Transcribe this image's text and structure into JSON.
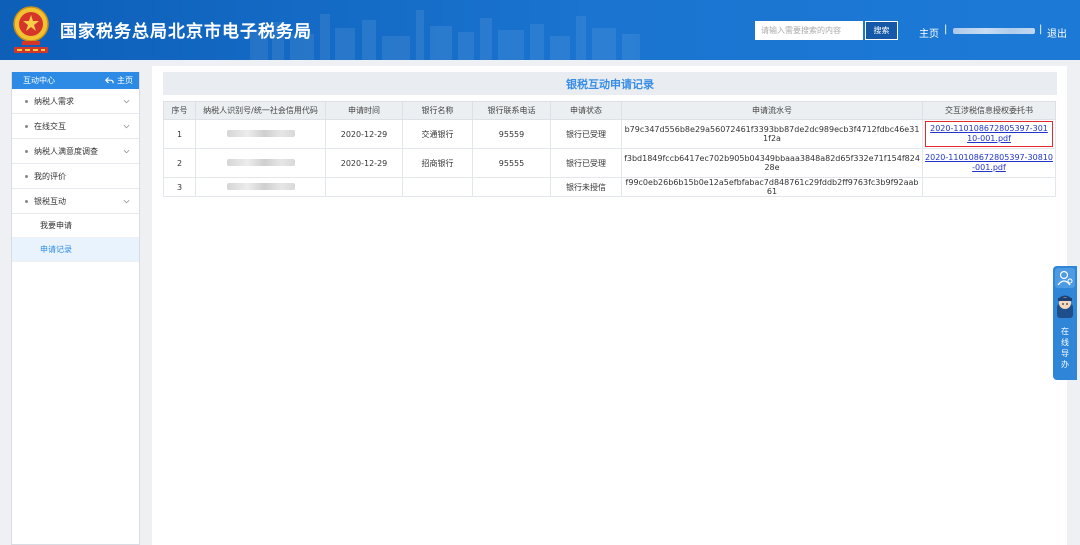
{
  "header": {
    "title": "国家税务总局北京市电子税务局",
    "search_placeholder": "请输入需要搜索的内容",
    "search_label": "搜索",
    "home_label": "主页",
    "separator": "|",
    "logout_label": "退出",
    "brand_color": "#1a6fcc"
  },
  "sidebar": {
    "header_label": "互动中心",
    "home_link": "主页",
    "items": [
      {
        "label": "纳税人需求",
        "icon": "chevron-down-icon"
      },
      {
        "label": "在线交互",
        "icon": "chevron-down-icon"
      },
      {
        "label": "纳税人满意度调查",
        "icon": "chevron-down-icon"
      },
      {
        "label": "我的评价"
      },
      {
        "label": "银税互动",
        "icon": "chevron-down-icon"
      }
    ],
    "sub_items": [
      {
        "label": "我要申请"
      },
      {
        "label": "申请记录",
        "active": true
      }
    ],
    "active_color": "#2d8be6"
  },
  "main": {
    "title": "银税互动申请记录",
    "columns": [
      "序号",
      "纳税人识别号/统一社会信用代码",
      "申请时间",
      "银行名称",
      "银行联系电话",
      "申请状态",
      "申请流水号",
      "交互涉税信息授权委托书"
    ],
    "rows": [
      {
        "no": "1",
        "date": "2020-12-29",
        "bank": "交通银行",
        "phone": "95559",
        "status": "银行已受理",
        "serial": "b79c347d556b8e29a56072461f3393bb87de2dc989ecb3f4712fdbc46e311f2a",
        "file": "2020-110108672805397-30110-001.pdf"
      },
      {
        "no": "2",
        "date": "2020-12-29",
        "bank": "招商银行",
        "phone": "95555",
        "status": "银行已受理",
        "serial": "f3bd1849fccb6417ec702b905b04349bbaaa3848a82d65f332e71f154f82428e",
        "file": "2020-110108672805397-30810-001.pdf"
      },
      {
        "no": "3",
        "date": "",
        "bank": "",
        "phone": "",
        "status": "银行未授信",
        "serial": "f99c0eb26b6b15b0e12a5efbfabac7d848761c29fddb2ff9763fc3b9f92aab61",
        "file": ""
      }
    ],
    "title_color": "#3a8ee6",
    "highlight_color": "#e8282b"
  },
  "float_assistant": {
    "label": "在线导办"
  }
}
